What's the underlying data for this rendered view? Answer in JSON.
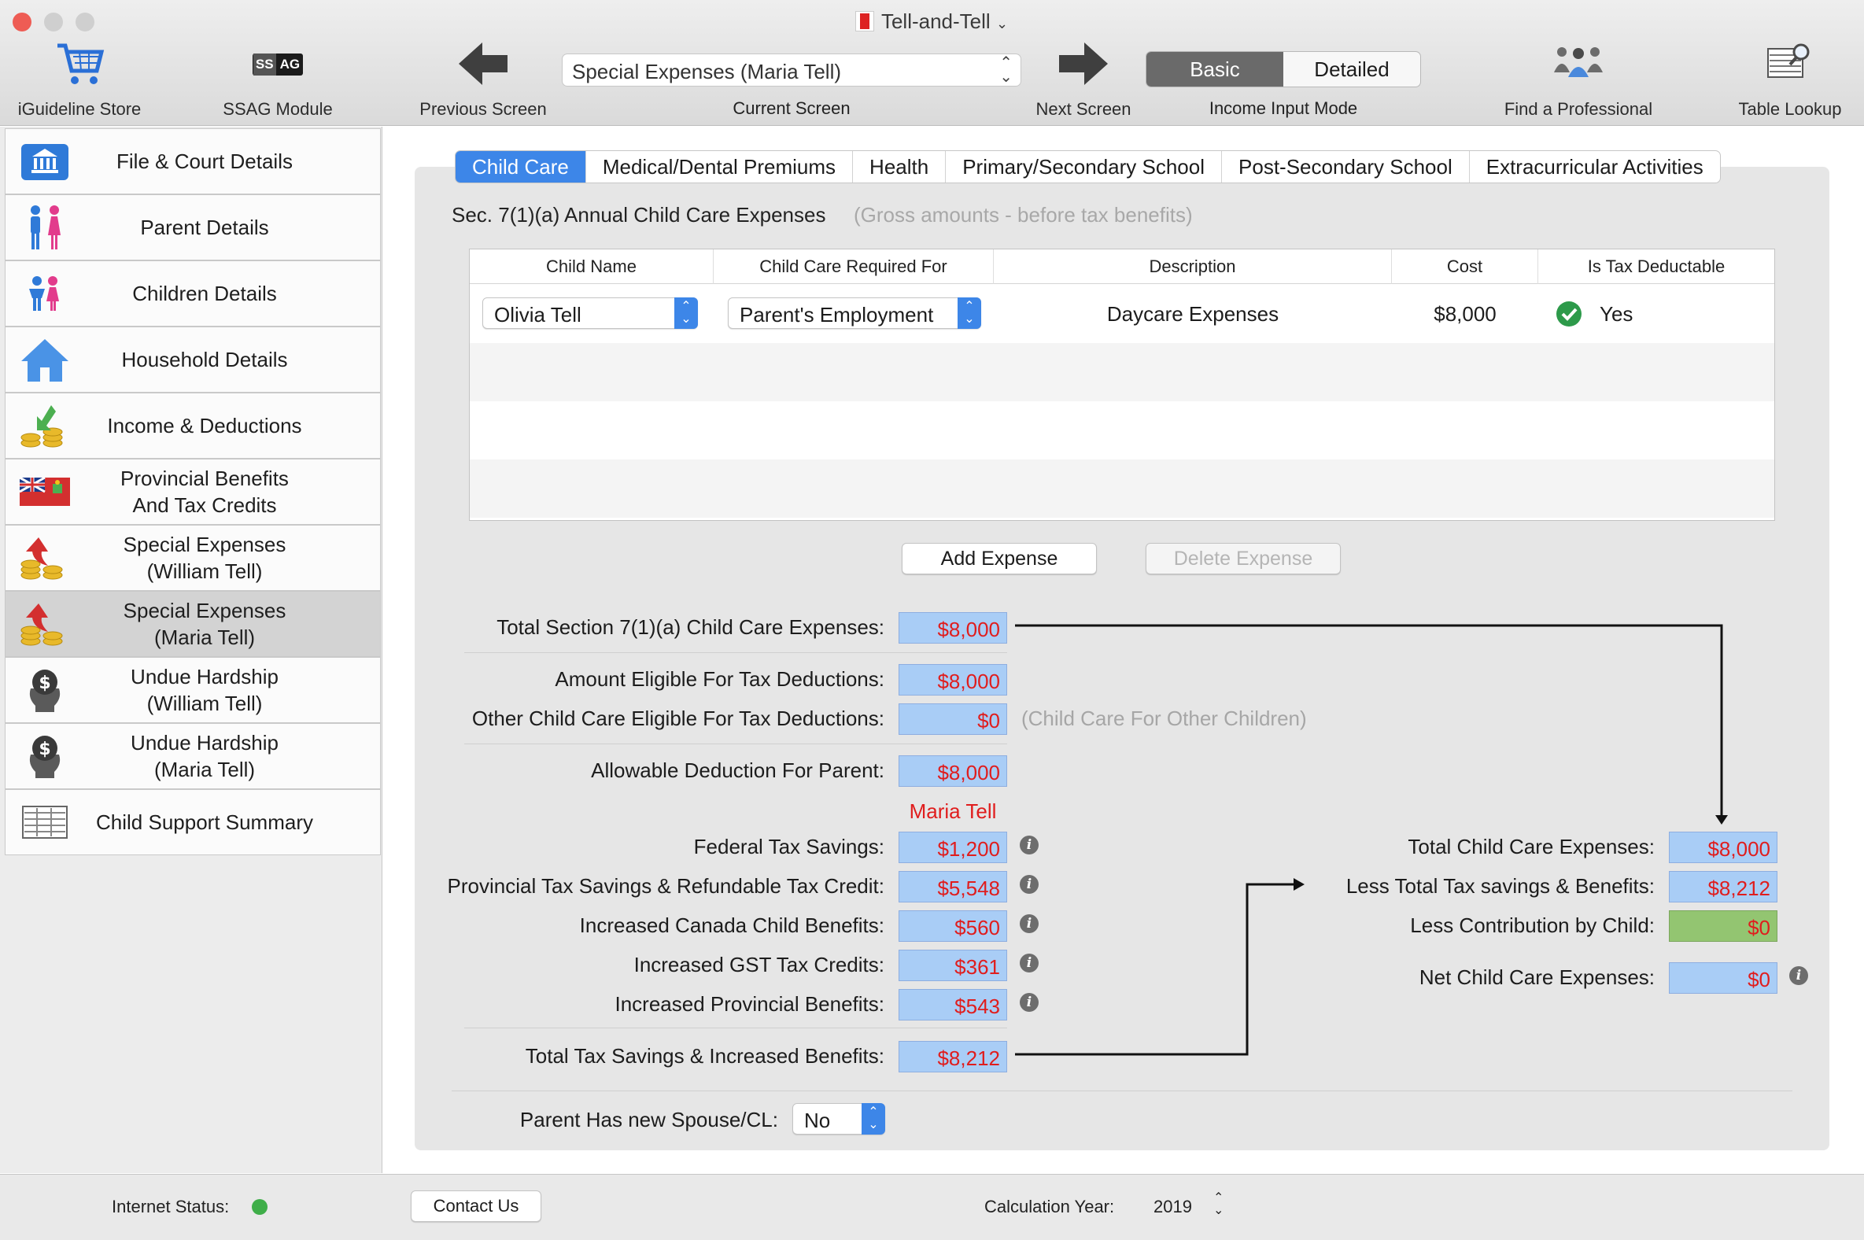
{
  "window": {
    "title": "Tell-and-Tell"
  },
  "toolbar": {
    "store_label": "iGuideline Store",
    "ssag_label": "SSAG Module",
    "ssag_badge_left": "SS",
    "ssag_badge_right": "AG",
    "prev_label": "Previous Screen",
    "current_screen_value": "Special Expenses (Maria Tell)",
    "current_screen_label": "Current Screen",
    "next_label": "Next Screen",
    "mode_basic": "Basic",
    "mode_detailed": "Detailed",
    "mode_label": "Income Input Mode",
    "find_label": "Find a Professional",
    "lookup_label": "Table Lookup"
  },
  "sidebar": {
    "items": [
      {
        "label": "File & Court Details",
        "icon": "courthouse-icon"
      },
      {
        "label": "Parent Details",
        "icon": "parents-icon"
      },
      {
        "label": "Children Details",
        "icon": "children-icon"
      },
      {
        "label": "Household Details",
        "icon": "house-icon"
      },
      {
        "label": "Income & Deductions",
        "icon": "coins-arrow-icon"
      },
      {
        "label": "Provincial Benefits\nAnd Tax Credits",
        "icon": "ontario-flag-icon"
      },
      {
        "label": "Special Expenses\n(William Tell)",
        "icon": "coins-up-arrow-icon"
      },
      {
        "label": "Special Expenses\n(Maria Tell)",
        "icon": "coins-up-arrow-icon"
      },
      {
        "label": "Undue Hardship\n(William Tell)",
        "icon": "hardship-icon"
      },
      {
        "label": "Undue Hardship\n(Maria Tell)",
        "icon": "hardship-icon"
      },
      {
        "label": "Child Support Summary",
        "icon": "table-icon"
      }
    ]
  },
  "tabs": [
    "Child Care",
    "Medical/Dental Premiums",
    "Health",
    "Primary/Secondary School",
    "Post-Secondary School",
    "Extracurricular Activities"
  ],
  "section": {
    "title": "Sec. 7(1)(a)  Annual Child Care Expenses",
    "note": "(Gross amounts - before tax benefits)"
  },
  "table": {
    "headers": [
      "Child Name",
      "Child Care Required For",
      "Description",
      "Cost",
      "Is Tax Deductable"
    ],
    "rows": [
      {
        "child": "Olivia Tell",
        "required_for": "Parent's Employment",
        "description": "Daycare Expenses",
        "cost": "$8,000",
        "deductible": "Yes"
      }
    ]
  },
  "buttons": {
    "add": "Add Expense",
    "delete": "Delete Expense"
  },
  "fields": {
    "total_section": {
      "label": "Total Section 7(1)(a) Child Care Expenses:",
      "value": "$8,000"
    },
    "eligible": {
      "label": "Amount Eligible For Tax Deductions:",
      "value": "$8,000"
    },
    "other_eligible": {
      "label": "Other Child Care Eligible For Tax Deductions:",
      "value": "$0",
      "note": "(Child Care For Other Children)"
    },
    "allowable": {
      "label": "Allowable Deduction For Parent:",
      "value": "$8,000"
    },
    "parent_name": "Maria Tell",
    "federal": {
      "label": "Federal Tax Savings:",
      "value": "$1,200"
    },
    "provincial": {
      "label": "Provincial Tax Savings & Refundable Tax Credit:",
      "value": "$5,548"
    },
    "ccb": {
      "label": "Increased Canada Child Benefits:",
      "value": "$560"
    },
    "gst": {
      "label": "Increased GST Tax Credits:",
      "value": "$361"
    },
    "prov_benefits": {
      "label": "Increased Provincial Benefits:",
      "value": "$543"
    },
    "total_savings": {
      "label": "Total Tax Savings & Increased Benefits:",
      "value": "$8,212"
    },
    "spouse": {
      "label": "Parent Has new Spouse/CL:",
      "value": "No"
    }
  },
  "summary": {
    "total": {
      "label": "Total Child Care Expenses:",
      "value": "$8,000"
    },
    "less_savings": {
      "label": "Less Total Tax savings & Benefits:",
      "value": "$8,212"
    },
    "less_child": {
      "label": "Less Contribution by Child:",
      "value": "$0"
    },
    "net": {
      "label": "Net Child Care Expenses:",
      "value": "$0"
    }
  },
  "status": {
    "internet_label": "Internet Status:",
    "internet_color": "#3fae49",
    "contact": "Contact Us",
    "year_label": "Calculation Year:",
    "year_value": "2019"
  },
  "colors": {
    "accent": "#3d86e8",
    "value_bg": "#a9cdf6",
    "value_text": "#e01d1d",
    "green_bg": "#93c571"
  }
}
